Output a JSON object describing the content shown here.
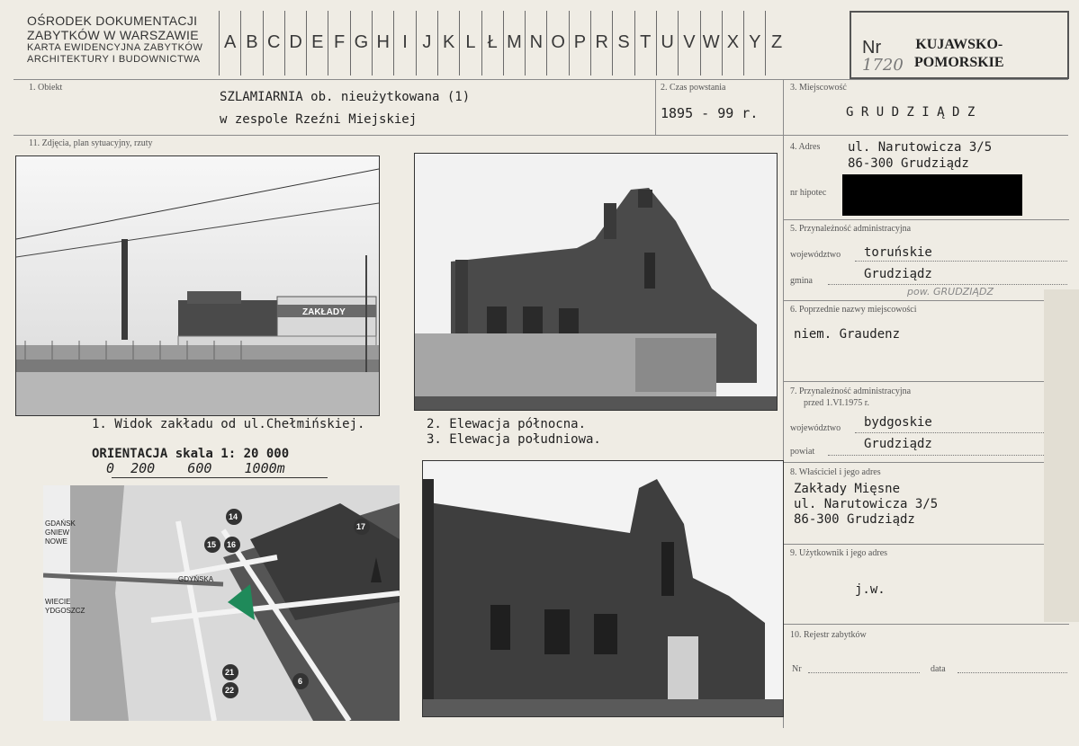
{
  "header": {
    "institution_line1": "OŚRODEK DOKUMENTACJI",
    "institution_line2": "ZABYTKÓW W WARSZAWIE",
    "institution_line3": "KARTA EWIDENCYJNA ZABYTKÓW",
    "institution_line4": "ARCHITEKTURY I BUDOWNICTWA",
    "alphabet": [
      "A",
      "B",
      "C",
      "D",
      "E",
      "F",
      "G",
      "H",
      "I",
      "J",
      "K",
      "L",
      "Ł",
      "M",
      "N",
      "O",
      "P",
      "R",
      "S",
      "T",
      "U",
      "V",
      "W",
      "X",
      "Y",
      "Z"
    ],
    "nr_label": "Nr",
    "nr_handwritten": "1720",
    "stamp_line1": "KUJAWSKO-",
    "stamp_line2": "POMORSKIE"
  },
  "fields": {
    "obiekt_label": "1. Obiekt",
    "obiekt_line1": "SZLAMIARNIA ob. nieużytkowana (1)",
    "obiekt_line2": "w zespole Rzeźni Miejskiej",
    "czas_label": "2. Czas powstania",
    "czas_value": "1895 - 99 r.",
    "miejscowosc_label": "3. Miejscowość",
    "miejscowosc_value": "G R U D Z I Ą D Z",
    "zdjecia_label": "11. Zdjęcia, plan sytuacyjny, rzuty",
    "adres_label": "4. Adres",
    "adres_line1": "ul. Narutowicza 3/5",
    "adres_line2": "86-300 Grudziądz",
    "hipoteka_label": "nr hipotec",
    "przynaleznosc_label": "5. Przynależność administracyjna",
    "wojewodztwo_label": "województwo",
    "wojewodztwo_value": "toruńskie",
    "gmina_label": "gmina",
    "gmina_value": "Grudziądz",
    "gmina_hand": "pow. GRUDZIĄDZ",
    "poprzednie_label": "6. Poprzednie nazwy miejscowości",
    "poprzednie_value": "niem. Graudenz",
    "przed_label1": "7. Przynależność administracyjna",
    "przed_label2": "przed 1.VI.1975 r.",
    "wojewodztwo2_value": "bydgoskie",
    "powiat_label": "powiat",
    "powiat_value": "Grudziądz",
    "wlasciciel_label": "8. Właściciel i jego adres",
    "wlasciciel_line1": "Zakłady Mięsne",
    "wlasciciel_line2": "ul. Narutowicza 3/5",
    "wlasciciel_line3": "86-300 Grudziądz",
    "uzytkownik_label": "9. Użytkownik i jego adres",
    "uzytkownik_value": "j.w.",
    "rejestr_label": "10. Rejestr zabytków",
    "rejestr_nr": "Nr",
    "rejestr_data": "data"
  },
  "captions": {
    "cap1": "1. Widok zakładu od ul.Chełmińskiej.",
    "cap2": "2. Elewacja północna.",
    "cap3": "3. Elewacja południowa.",
    "orient": "ORIENTACJA skala 1: 20 000",
    "scale": "0  200    600    1000m",
    "sign": "ZAKŁADY"
  },
  "map_labels": {
    "gdansk": "GDAŃSK",
    "gniew": "GNIEW",
    "nowe": "NOWE",
    "wiecie": "WIECIE",
    "bydgoszcz": "YDGOSZCZ",
    "gdynska": "GDYŃSKA",
    "n14": "14",
    "n15": "15",
    "n16": "16",
    "n17": "17",
    "n21": "21",
    "n22": "22",
    "n6": "6"
  },
  "colors": {
    "paper": "#efece4",
    "ink": "#222222",
    "map_marker": "#1f8a5a"
  }
}
